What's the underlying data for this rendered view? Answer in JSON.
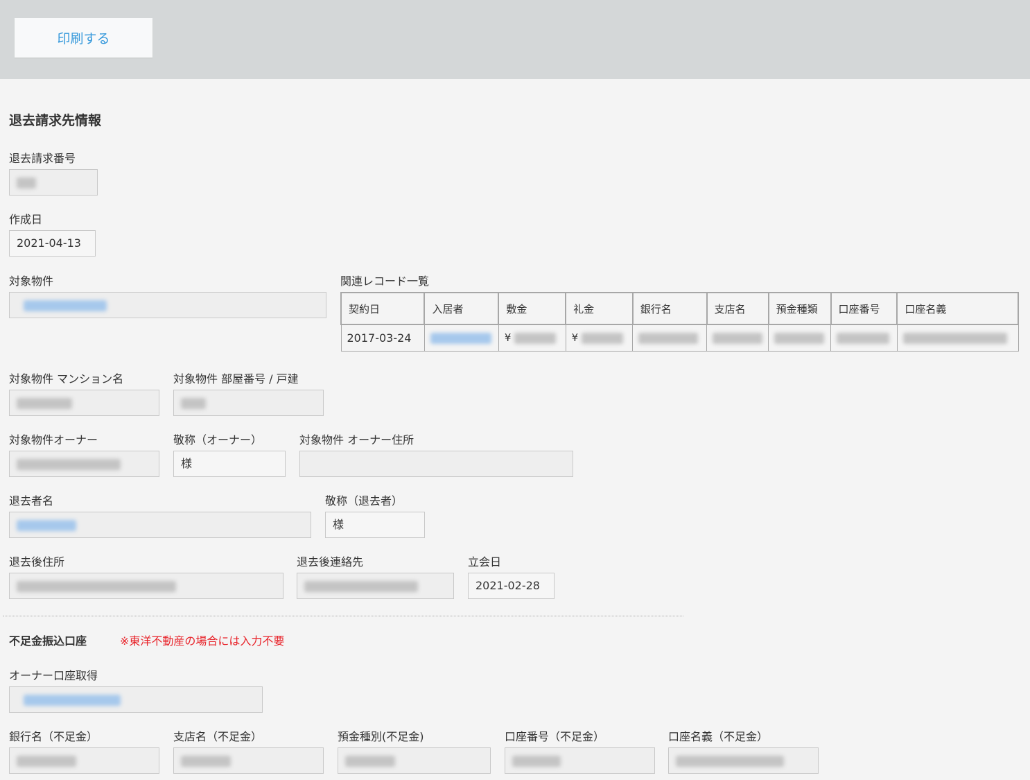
{
  "toolbar": {
    "print_label": "印刷する"
  },
  "section_title": "退去請求先情報",
  "fields": {
    "claim_number": {
      "label": "退去請求番号"
    },
    "created_date": {
      "label": "作成日",
      "value": "2021-04-13"
    },
    "target_property": {
      "label": "対象物件"
    },
    "mansion_name": {
      "label": "対象物件 マンション名"
    },
    "room_number": {
      "label": "対象物件 部屋番号 / 戸建"
    },
    "owner": {
      "label": "対象物件オーナー"
    },
    "owner_honorific": {
      "label": "敬称（オーナー）",
      "value": "様"
    },
    "owner_address": {
      "label": "対象物件 オーナー住所",
      "value": ""
    },
    "tenant_name": {
      "label": "退去者名"
    },
    "tenant_honorific": {
      "label": "敬称（退去者）",
      "value": "様"
    },
    "new_address": {
      "label": "退去後住所"
    },
    "new_contact": {
      "label": "退去後連絡先"
    },
    "inspection_date": {
      "label": "立会日",
      "value": "2021-02-28"
    }
  },
  "related": {
    "title": "関連レコード一覧",
    "columns": [
      "契約日",
      "入居者",
      "敷金",
      "礼金",
      "銀行名",
      "支店名",
      "預金種類",
      "口座番号",
      "口座名義"
    ],
    "row": {
      "contract_date": "2017-03-24",
      "deposit_prefix": "¥",
      "key_money_prefix": "¥"
    }
  },
  "shortage": {
    "title": "不足金振込口座",
    "warning": "※東洋不動産の場合には入力不要",
    "owner_account_label": "オーナー口座取得",
    "bank_label": "銀行名（不足金）",
    "branch_label": "支店名（不足金）",
    "type_label": "預金種別(不足金)",
    "account_no_label": "口座番号（不足金）",
    "holder_label": "口座名義（不足金）"
  }
}
